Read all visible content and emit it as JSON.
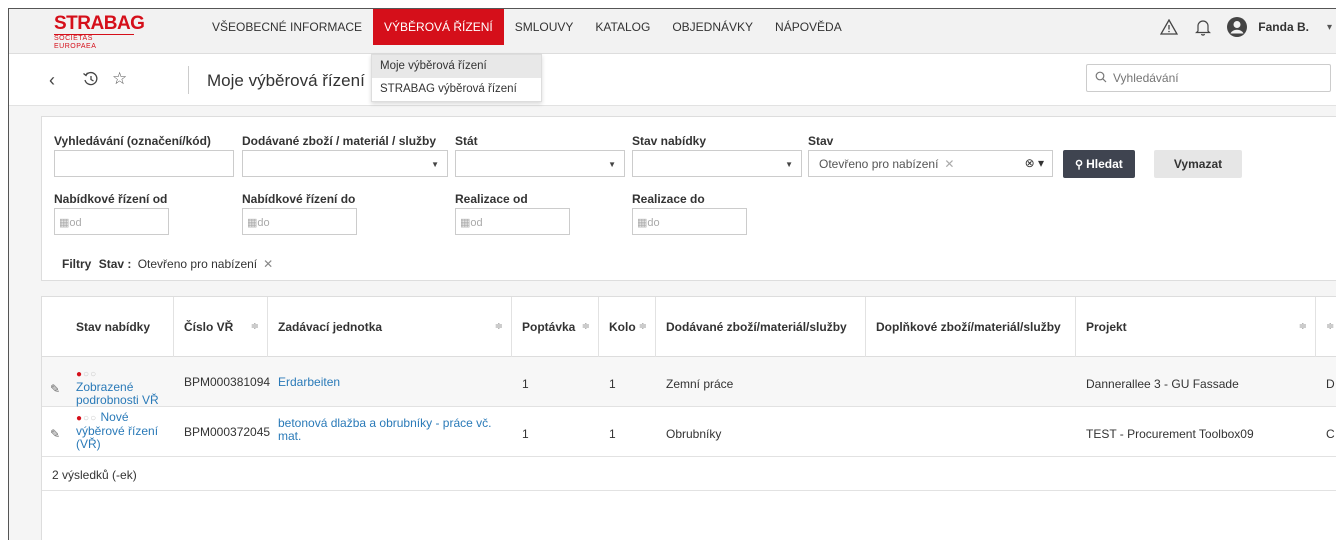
{
  "brand": {
    "logo_main": "STRABAG",
    "logo_sub": "SOCIETAS EUROPAEA",
    "color": "#d50f1a"
  },
  "topnav": {
    "items": [
      {
        "label": "VŠEOBECNÉ INFORMACE",
        "active": false
      },
      {
        "label": "VÝBĚROVÁ ŘÍZENÍ",
        "active": true
      },
      {
        "label": "SMLOUVY",
        "active": false
      },
      {
        "label": "KATALOG",
        "active": false
      },
      {
        "label": "OBJEDNÁVKY",
        "active": false
      },
      {
        "label": "NÁPOVĚDA",
        "active": false
      }
    ],
    "icons": [
      "warning-icon",
      "bell-icon",
      "user-avatar-icon"
    ],
    "user_name": "Fanda B."
  },
  "dropdown": {
    "items": [
      "Moje výběrová řízení",
      "STRABAG výběrová řízení"
    ]
  },
  "subbar": {
    "title": "Moje výběrová řízení",
    "search_placeholder": "Vyhledávání"
  },
  "filters": {
    "search_label": "Vyhledávání (označení/kód)",
    "goods_label": "Dodávané zboží / materiál / služby",
    "country_label": "Stát",
    "offer_state_label": "Stav nabídky",
    "state_label": "Stav",
    "state_value": "Otevřeno pro nabízení",
    "search_button": "Hledat",
    "clear_button": "Vymazat",
    "from_label": "Nabídkové řízení od",
    "to_label": "Nabídkové řízení do",
    "real_from_label": "Realizace od",
    "real_to_label": "Realizace do",
    "ph_from": "od",
    "ph_to": "do",
    "active_filters_label": "Filtry",
    "active_filter_key": "Stav :",
    "active_filter_value": "Otevřeno pro nabízení"
  },
  "table": {
    "columns": [
      "Stav nabídky",
      "Číslo VŘ",
      "Zadávací jednotka",
      "Poptávka",
      "Kolo",
      "Dodávané zboží/materiál/služby",
      "Doplňkové zboží/materiál/služby",
      "Projekt"
    ],
    "rows": [
      {
        "status": "Zobrazené podrobnosti VŘ",
        "status_line1": "Zobrazené",
        "status_line2": "podrobnosti VŘ",
        "number": "BPM000381094",
        "unit": "Erdarbeiten",
        "unit_line2": "",
        "request": "1",
        "round": "1",
        "goods": "Zemní práce",
        "extra": "",
        "project": "Dannerallee 3 - GU Fassade",
        "tail": "D"
      },
      {
        "status_first": "Nové",
        "status_line1": "výběrové řízení",
        "status_line2": "(VŘ)",
        "number": "BPM000372045",
        "unit": "betonová dlažba a obrubníky - práce vč.",
        "unit_line2": "mat.",
        "request": "1",
        "round": "1",
        "goods": "Obrubníky",
        "extra": "",
        "project": "TEST - Procurement Toolbox09",
        "tail": "C"
      }
    ],
    "footer": "2 výsledků (-ek)"
  }
}
